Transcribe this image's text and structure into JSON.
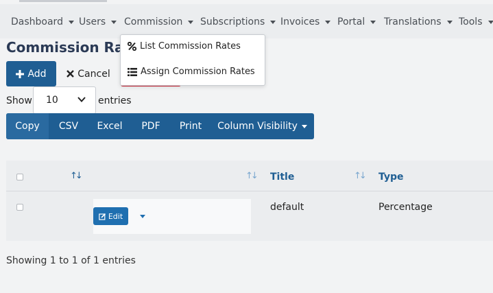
{
  "navbar": {
    "items": [
      "Dashboard",
      "Users",
      "Commission",
      "Subscriptions",
      "Invoices",
      "Portal",
      "Translations",
      "Tools"
    ]
  },
  "page": {
    "title": "Commission Rates"
  },
  "toolbar": {
    "add_label": "Add",
    "cancel_label": "Cancel"
  },
  "dropdown": {
    "items": [
      "List Commission Rates",
      "Assign Commission Rates"
    ]
  },
  "entries": {
    "show_label": "Show",
    "value": "10",
    "suffix": "entries"
  },
  "export": {
    "buttons": [
      "Copy",
      "CSV",
      "Excel",
      "PDF",
      "Print",
      "Column Visibility"
    ]
  },
  "table": {
    "headers": [
      "Title",
      "Type"
    ],
    "rows": [
      {
        "edit_label": "Edit",
        "title": "default",
        "type": "Percentage"
      }
    ]
  },
  "footer": {
    "info": "Showing 1 to 1 of 1 entries"
  },
  "colors": {
    "primary": "#1f5e93",
    "danger": "#d22030",
    "link": "#1f5e93"
  }
}
